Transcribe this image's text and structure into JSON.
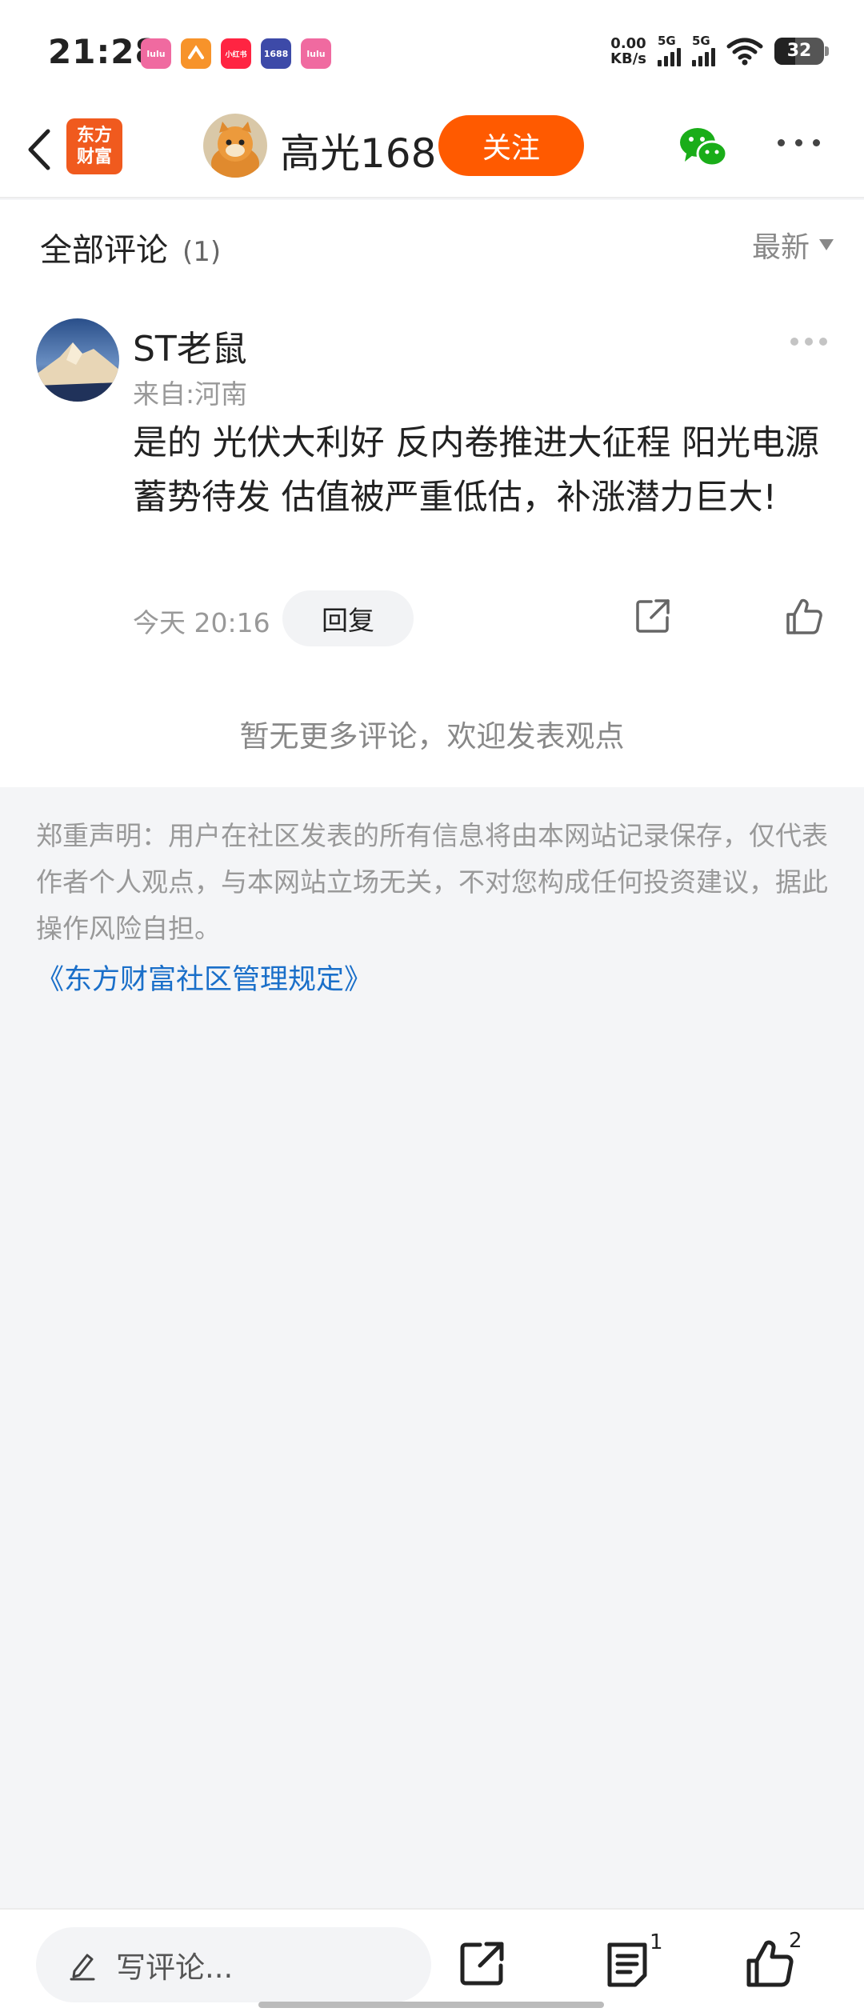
{
  "status_bar": {
    "time": "21:28",
    "app_icons": [
      {
        "name": "lulu-icon",
        "label": "lulu",
        "color": "#f06aa0"
      },
      {
        "name": "orange-app-icon",
        "label": "",
        "color": "#f7932a"
      },
      {
        "name": "xiaohongshu-icon",
        "label": "小红书",
        "color": "#ff2442"
      },
      {
        "name": "1688-icon",
        "label": "1688",
        "color": "#3d4aa8"
      },
      {
        "name": "lulu-icon-2",
        "label": "lulu",
        "color": "#f06aa0"
      }
    ],
    "net_speed_value": "0.00",
    "net_speed_unit": "KB/s",
    "signal1_label": "5G",
    "signal2_label": "5G",
    "battery": "32"
  },
  "nav": {
    "brand_line1": "东方",
    "brand_line2": "财富",
    "username": "高光168",
    "follow_label": "关注"
  },
  "comments_section": {
    "title": "全部评论",
    "count": "(1)",
    "sort_label": "最新"
  },
  "comment": {
    "username": "ST老鼠",
    "location": "来自:河南",
    "text": "是的 光伏大利好 反内卷推进大征程 阳光电源蓄势待发 估值被严重低估，补涨潜力巨大!",
    "time": "今天 20:16",
    "reply_label": "回复"
  },
  "no_more_text": "暂无更多评论，欢迎发表观点",
  "disclaimer": "郑重声明：用户在社区发表的所有信息将由本网站记录保存，仅代表作者个人观点，与本网站立场无关，不对您构成任何投资建议，据此操作风险自担。",
  "rules_link": "《东方财富社区管理规定》",
  "bottom_bar": {
    "placeholder": "写评论...",
    "comments_badge": "1",
    "likes_badge": "2"
  },
  "colors": {
    "accent": "#ff5a00",
    "brand": "#f05a1e",
    "link": "#1a6fc9",
    "wechat": "#1aad19"
  }
}
